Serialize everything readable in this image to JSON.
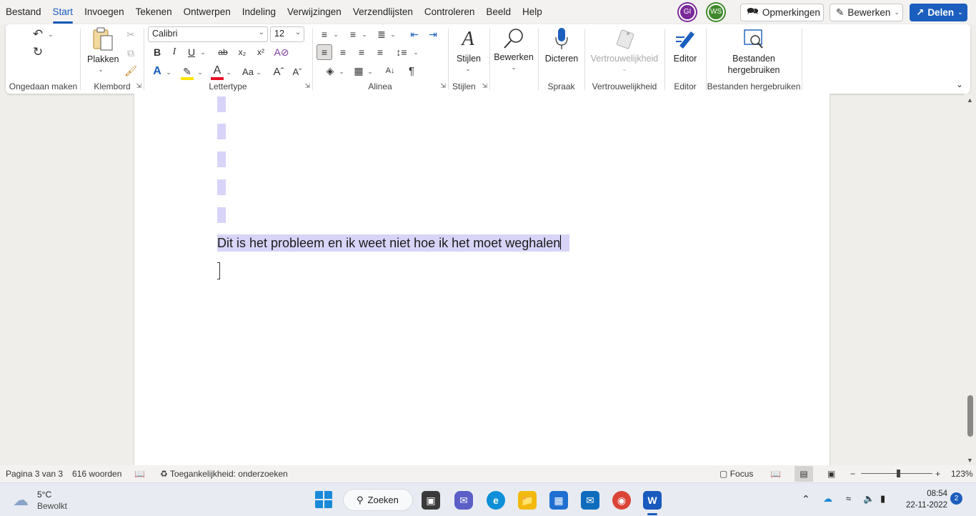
{
  "menu": {
    "tabs": [
      "Bestand",
      "Start",
      "Invoegen",
      "Tekenen",
      "Ontwerpen",
      "Indeling",
      "Verwijzingen",
      "Verzendlijsten",
      "Controleren",
      "Beeld",
      "Help"
    ],
    "active_tab": "Start",
    "avatars": [
      "GI",
      "WS"
    ],
    "comments_label": "Opmerkingen",
    "edit_label": "Bewerken",
    "share_label": "Delen"
  },
  "ribbon": {
    "groups": {
      "undo": "Ongedaan maken",
      "clipboard": "Klembord",
      "font": "Lettertype",
      "paragraph": "Alinea",
      "styles": "Stijlen",
      "voice": "Spraak",
      "sensitivity": "Vertrouwelijkheid",
      "editor": "Editor",
      "reuse": "Bestanden hergebruiken"
    },
    "paste_label": "Plakken",
    "font_name": "Calibri",
    "font_size": "12",
    "styles_label": "Stijlen",
    "editing_label": "Bewerken",
    "dictate_label": "Dicteren",
    "sensitivity_label": "Vertrouwelijkheid",
    "editor_label": "Editor",
    "reuse_label_1": "Bestanden",
    "reuse_label_2": "hergebruiken",
    "font_buttons": {
      "bold": "B",
      "italic": "I",
      "underline": "U",
      "strike": "ab",
      "change_case": "Aa"
    }
  },
  "document": {
    "text": "Dit is het probleem en ik weet niet hoe ik het moet weghalen"
  },
  "status": {
    "page": "Pagina 3 van 3",
    "words": "616 woorden",
    "accessibility": "Toegankelijkheid: onderzoeken",
    "focus": "Focus",
    "zoom": "123%"
  },
  "taskbar": {
    "temperature": "5°C",
    "weather": "Bewolkt",
    "search_label": "Zoeken",
    "time": "08:54",
    "date": "22-11-2022",
    "notifications": "2"
  },
  "colors": {
    "accent": "#185abd",
    "selection": "#d7d4f8",
    "share_button": "#1b5ebe"
  }
}
